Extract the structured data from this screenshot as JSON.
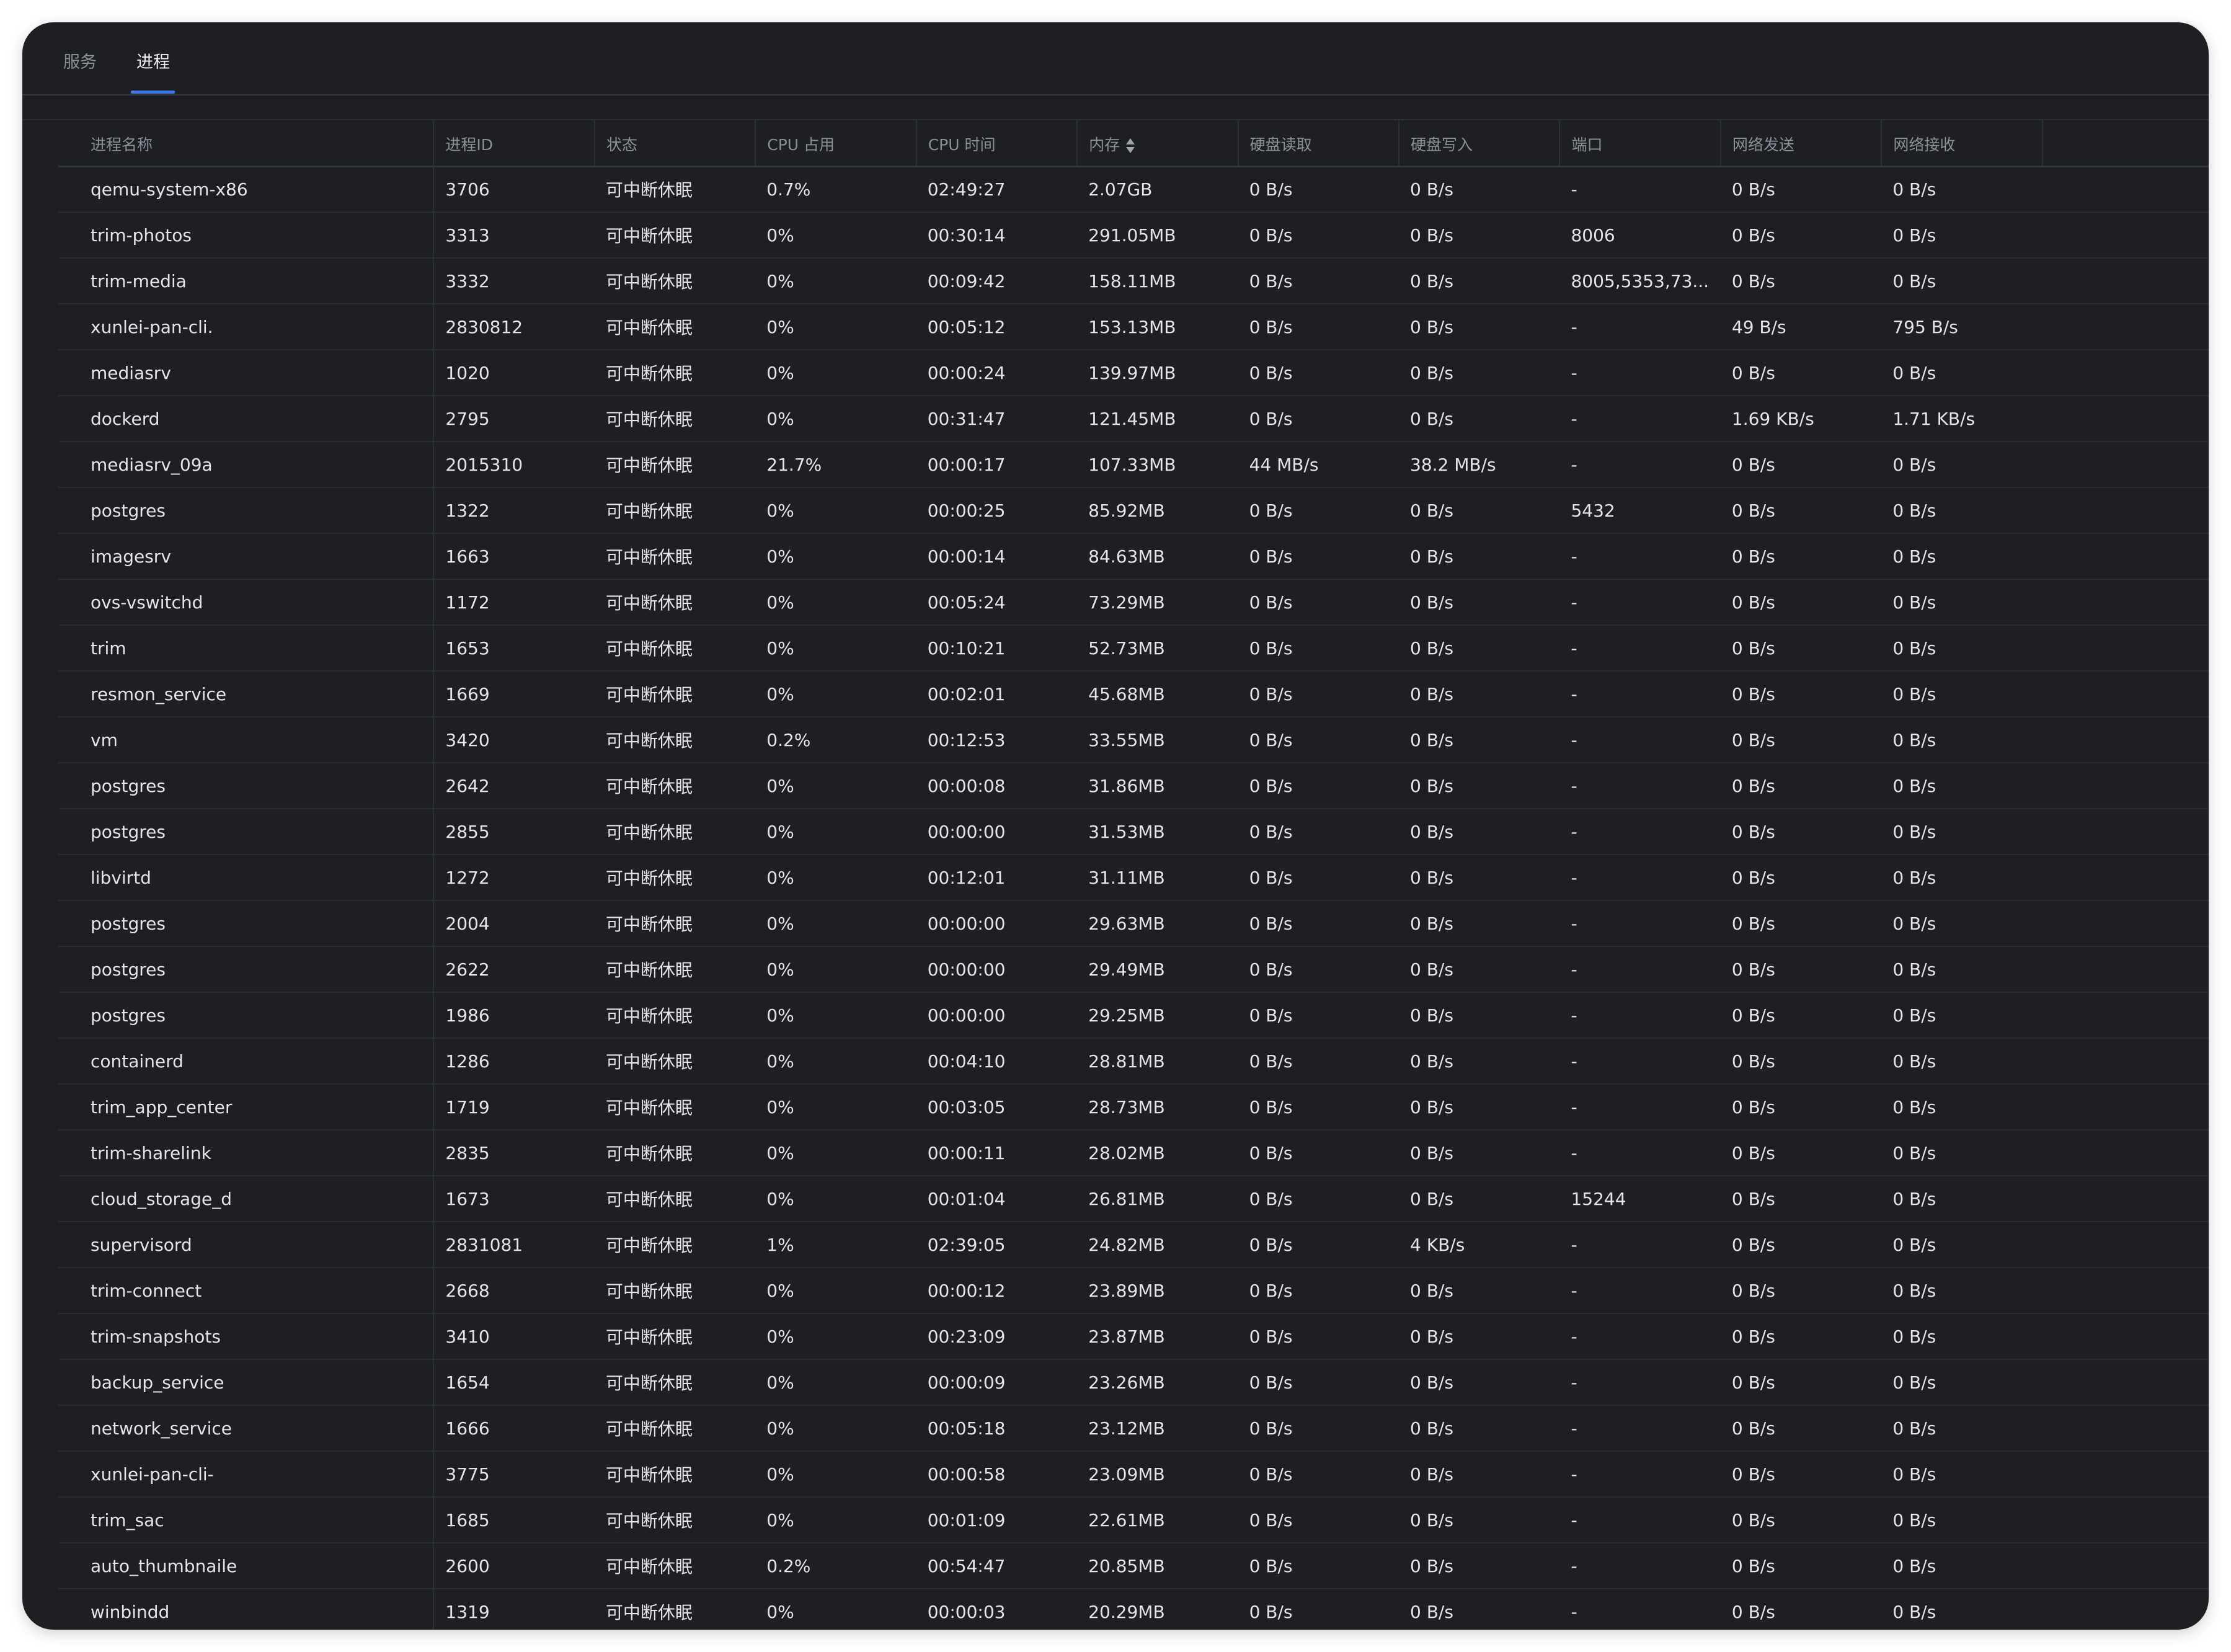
{
  "tabs": [
    {
      "label": "服务",
      "active": false
    },
    {
      "label": "进程",
      "active": true
    }
  ],
  "columns": [
    "进程名称",
    "进程ID",
    "状态",
    "CPU 占用",
    "CPU 时间",
    "内存",
    "硬盘读取",
    "硬盘写入",
    "端口",
    "网络发送",
    "网络接收"
  ],
  "sort": {
    "column": "内存",
    "icon": "sort-icon"
  },
  "colors": {
    "background": "#1d1f23",
    "accent": "#3a78f2",
    "text": "#e3e5e9",
    "muted": "#8a8f98"
  },
  "rows": [
    [
      "qemu-system-x86",
      "3706",
      "可中断休眠",
      "0.7%",
      "02:49:27",
      "2.07GB",
      "0 B/s",
      "0 B/s",
      "-",
      "0 B/s",
      "0 B/s"
    ],
    [
      "trim-photos",
      "3313",
      "可中断休眠",
      "0%",
      "00:30:14",
      "291.05MB",
      "0 B/s",
      "0 B/s",
      "8006",
      "0 B/s",
      "0 B/s"
    ],
    [
      "trim-media",
      "3332",
      "可中断休眠",
      "0%",
      "00:09:42",
      "158.11MB",
      "0 B/s",
      "0 B/s",
      "8005,5353,73...",
      "0 B/s",
      "0 B/s"
    ],
    [
      "xunlei-pan-cli.",
      "2830812",
      "可中断休眠",
      "0%",
      "00:05:12",
      "153.13MB",
      "0 B/s",
      "0 B/s",
      "-",
      "49 B/s",
      "795 B/s"
    ],
    [
      "mediasrv",
      "1020",
      "可中断休眠",
      "0%",
      "00:00:24",
      "139.97MB",
      "0 B/s",
      "0 B/s",
      "-",
      "0 B/s",
      "0 B/s"
    ],
    [
      "dockerd",
      "2795",
      "可中断休眠",
      "0%",
      "00:31:47",
      "121.45MB",
      "0 B/s",
      "0 B/s",
      "-",
      "1.69 KB/s",
      "1.71 KB/s"
    ],
    [
      "mediasrv_09a",
      "2015310",
      "可中断休眠",
      "21.7%",
      "00:00:17",
      "107.33MB",
      "44 MB/s",
      "38.2 MB/s",
      "-",
      "0 B/s",
      "0 B/s"
    ],
    [
      "postgres",
      "1322",
      "可中断休眠",
      "0%",
      "00:00:25",
      "85.92MB",
      "0 B/s",
      "0 B/s",
      "5432",
      "0 B/s",
      "0 B/s"
    ],
    [
      "imagesrv",
      "1663",
      "可中断休眠",
      "0%",
      "00:00:14",
      "84.63MB",
      "0 B/s",
      "0 B/s",
      "-",
      "0 B/s",
      "0 B/s"
    ],
    [
      "ovs-vswitchd",
      "1172",
      "可中断休眠",
      "0%",
      "00:05:24",
      "73.29MB",
      "0 B/s",
      "0 B/s",
      "-",
      "0 B/s",
      "0 B/s"
    ],
    [
      "trim",
      "1653",
      "可中断休眠",
      "0%",
      "00:10:21",
      "52.73MB",
      "0 B/s",
      "0 B/s",
      "-",
      "0 B/s",
      "0 B/s"
    ],
    [
      "resmon_service",
      "1669",
      "可中断休眠",
      "0%",
      "00:02:01",
      "45.68MB",
      "0 B/s",
      "0 B/s",
      "-",
      "0 B/s",
      "0 B/s"
    ],
    [
      "vm",
      "3420",
      "可中断休眠",
      "0.2%",
      "00:12:53",
      "33.55MB",
      "0 B/s",
      "0 B/s",
      "-",
      "0 B/s",
      "0 B/s"
    ],
    [
      "postgres",
      "2642",
      "可中断休眠",
      "0%",
      "00:00:08",
      "31.86MB",
      "0 B/s",
      "0 B/s",
      "-",
      "0 B/s",
      "0 B/s"
    ],
    [
      "postgres",
      "2855",
      "可中断休眠",
      "0%",
      "00:00:00",
      "31.53MB",
      "0 B/s",
      "0 B/s",
      "-",
      "0 B/s",
      "0 B/s"
    ],
    [
      "libvirtd",
      "1272",
      "可中断休眠",
      "0%",
      "00:12:01",
      "31.11MB",
      "0 B/s",
      "0 B/s",
      "-",
      "0 B/s",
      "0 B/s"
    ],
    [
      "postgres",
      "2004",
      "可中断休眠",
      "0%",
      "00:00:00",
      "29.63MB",
      "0 B/s",
      "0 B/s",
      "-",
      "0 B/s",
      "0 B/s"
    ],
    [
      "postgres",
      "2622",
      "可中断休眠",
      "0%",
      "00:00:00",
      "29.49MB",
      "0 B/s",
      "0 B/s",
      "-",
      "0 B/s",
      "0 B/s"
    ],
    [
      "postgres",
      "1986",
      "可中断休眠",
      "0%",
      "00:00:00",
      "29.25MB",
      "0 B/s",
      "0 B/s",
      "-",
      "0 B/s",
      "0 B/s"
    ],
    [
      "containerd",
      "1286",
      "可中断休眠",
      "0%",
      "00:04:10",
      "28.81MB",
      "0 B/s",
      "0 B/s",
      "-",
      "0 B/s",
      "0 B/s"
    ],
    [
      "trim_app_center",
      "1719",
      "可中断休眠",
      "0%",
      "00:03:05",
      "28.73MB",
      "0 B/s",
      "0 B/s",
      "-",
      "0 B/s",
      "0 B/s"
    ],
    [
      "trim-sharelink",
      "2835",
      "可中断休眠",
      "0%",
      "00:00:11",
      "28.02MB",
      "0 B/s",
      "0 B/s",
      "-",
      "0 B/s",
      "0 B/s"
    ],
    [
      "cloud_storage_d",
      "1673",
      "可中断休眠",
      "0%",
      "00:01:04",
      "26.81MB",
      "0 B/s",
      "0 B/s",
      "15244",
      "0 B/s",
      "0 B/s"
    ],
    [
      "supervisord",
      "2831081",
      "可中断休眠",
      "1%",
      "02:39:05",
      "24.82MB",
      "0 B/s",
      "4 KB/s",
      "-",
      "0 B/s",
      "0 B/s"
    ],
    [
      "trim-connect",
      "2668",
      "可中断休眠",
      "0%",
      "00:00:12",
      "23.89MB",
      "0 B/s",
      "0 B/s",
      "-",
      "0 B/s",
      "0 B/s"
    ],
    [
      "trim-snapshots",
      "3410",
      "可中断休眠",
      "0%",
      "00:23:09",
      "23.87MB",
      "0 B/s",
      "0 B/s",
      "-",
      "0 B/s",
      "0 B/s"
    ],
    [
      "backup_service",
      "1654",
      "可中断休眠",
      "0%",
      "00:00:09",
      "23.26MB",
      "0 B/s",
      "0 B/s",
      "-",
      "0 B/s",
      "0 B/s"
    ],
    [
      "network_service",
      "1666",
      "可中断休眠",
      "0%",
      "00:05:18",
      "23.12MB",
      "0 B/s",
      "0 B/s",
      "-",
      "0 B/s",
      "0 B/s"
    ],
    [
      "xunlei-pan-cli-",
      "3775",
      "可中断休眠",
      "0%",
      "00:00:58",
      "23.09MB",
      "0 B/s",
      "0 B/s",
      "-",
      "0 B/s",
      "0 B/s"
    ],
    [
      "trim_sac",
      "1685",
      "可中断休眠",
      "0%",
      "00:01:09",
      "22.61MB",
      "0 B/s",
      "0 B/s",
      "-",
      "0 B/s",
      "0 B/s"
    ],
    [
      "auto_thumbnaile",
      "2600",
      "可中断休眠",
      "0.2%",
      "00:54:47",
      "20.85MB",
      "0 B/s",
      "0 B/s",
      "-",
      "0 B/s",
      "0 B/s"
    ],
    [
      "winbindd",
      "1319",
      "可中断休眠",
      "0%",
      "00:00:03",
      "20.29MB",
      "0 B/s",
      "0 B/s",
      "-",
      "0 B/s",
      "0 B/s"
    ]
  ]
}
